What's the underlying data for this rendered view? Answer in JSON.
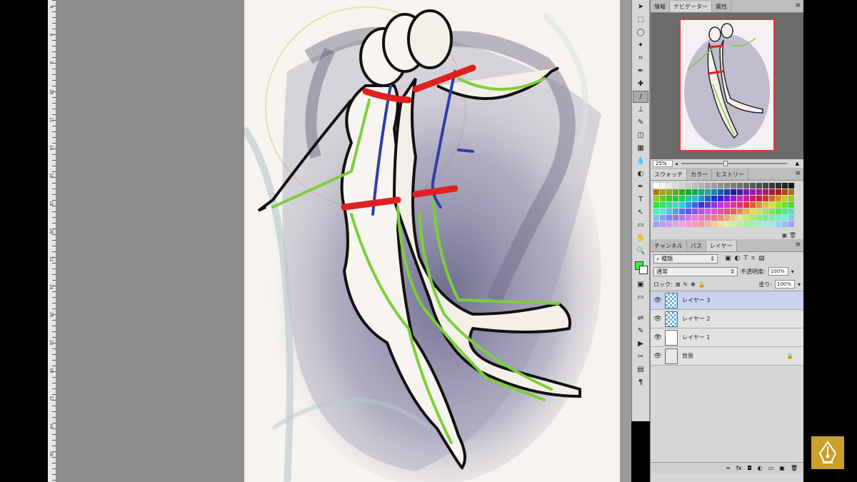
{
  "ruler": {
    "numbers": [
      "4",
      "6",
      "8",
      "10",
      "12",
      "14",
      "16",
      "18",
      "20",
      "22",
      "24",
      "26",
      "28",
      "30",
      "32",
      "34",
      "36"
    ]
  },
  "toolbar": {
    "tools": [
      "move-icon",
      "marquee-icon",
      "lasso-icon",
      "quick-select-icon",
      "crop-icon",
      "eyedropper-icon",
      "spot-heal-icon",
      "brush-icon",
      "stamp-icon",
      "history-brush-icon",
      "eraser-icon",
      "gradient-icon",
      "blur-icon",
      "dodge-icon",
      "pen-icon",
      "type-icon",
      "path-select-icon",
      "shape-icon",
      "hand-icon",
      "zoom-icon"
    ],
    "tool_glyphs": [
      "➤",
      "⬚",
      "◯",
      "✦",
      "⌗",
      "✒",
      "✚",
      "/",
      "⊥",
      "✎",
      "◫",
      "▦",
      "💧",
      "◐",
      "✒",
      "T",
      "↖",
      "▭",
      "✋",
      "🔍"
    ],
    "active_tool": "brush-icon",
    "foreground_color": "#3cf03c",
    "background_color": "#ffffff"
  },
  "side_toolbar": {
    "icons": [
      "adjust-icon",
      "brush-presets-icon",
      "actions-icon",
      "tools-icon",
      "notes-icon",
      "paragraph-icon"
    ],
    "glyphs": [
      "⇌",
      "✎",
      "▶",
      "✂",
      "▤",
      "¶"
    ]
  },
  "navigator_panel": {
    "tabs": [
      "情報",
      "ナビゲーター",
      "属性"
    ],
    "active_tab": "ナビゲーター",
    "zoom": "25%"
  },
  "swatches_panel": {
    "tabs": [
      "スウォッチ",
      "カラー",
      "ヒストリー"
    ],
    "active_tab": "スウォッチ"
  },
  "layers_panel": {
    "tabs": [
      "チャンネル",
      "パス",
      "レイヤー"
    ],
    "active_tab": "レイヤー",
    "filter_label": "種類",
    "blend_mode": "通常",
    "opacity_label": "不透明度:",
    "opacity_value": "100%",
    "lock_label": "ロック:",
    "fill_label": "塗り:",
    "fill_value": "100%",
    "layers": [
      {
        "name": "レイヤー 3",
        "selected": true,
        "thumb": "checker"
      },
      {
        "name": "レイヤー 2",
        "selected": false,
        "thumb": "checker"
      },
      {
        "name": "レイヤー 1",
        "selected": false,
        "thumb": "white"
      },
      {
        "name": "背景",
        "selected": false,
        "thumb": "art",
        "locked": true
      }
    ],
    "bottom_icons": [
      "∞",
      "fx",
      "◘",
      "◐",
      "▭",
      "▣",
      "🗑"
    ]
  },
  "colors": {
    "accent_red": "#e02020",
    "guide_green": "#7ccf3a",
    "arrow_blue": "#2c3fa8",
    "selected_layer": "#c9d3ee"
  }
}
